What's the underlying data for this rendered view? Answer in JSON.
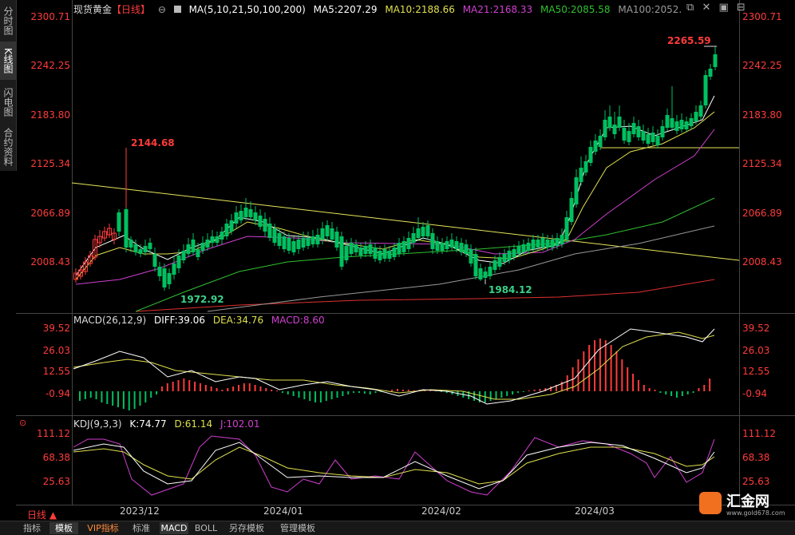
{
  "sidebar": {
    "tabs": [
      {
        "label": "分时图",
        "active": false
      },
      {
        "label": "K线图",
        "active": true
      },
      {
        "label": "闪电图",
        "active": false
      },
      {
        "label": "合约资料",
        "active": false
      }
    ]
  },
  "legend_main": {
    "symbol": "现货黄金",
    "period": "【日线】",
    "ma_spec": "MA(5,10,21,50,100,200)",
    "ma5": "MA5:2207.29",
    "ma10": "MA10:2188.66",
    "ma21": "MA21:2168.33",
    "ma50": "MA50:2085.58",
    "ma100": "MA100:2052."
  },
  "legend_macd": {
    "label": "MACD(26,12,9)",
    "diff": "DIFF:39.06",
    "dea": "DEA:34.76",
    "macd": "MACD:8.60"
  },
  "legend_kdj": {
    "label": "KDJ(9,3,3)",
    "k": "K:74.77",
    "d": "D:61.14",
    "j": "J:102.01"
  },
  "price_axis": [
    "2300.71",
    "2242.25",
    "2183.80",
    "2125.34",
    "2066.89",
    "2008.43"
  ],
  "macd_axis": [
    "39.52",
    "26.03",
    "12.55",
    "-0.94"
  ],
  "kdj_axis": [
    "111.12",
    "68.38",
    "25.63"
  ],
  "x_labels": [
    "2023/12",
    "2024/01",
    "2024/02",
    "2024/03"
  ],
  "period_type": "日线 ▲",
  "annotations": {
    "high1": "2144.68",
    "low1": "1972.92",
    "low2": "1984.12",
    "high2": "2265.59"
  },
  "bottom_tabs": [
    {
      "label": "指标",
      "active": false
    },
    {
      "label": "模板",
      "active": true
    },
    {
      "label": "VIP指标",
      "active": false
    },
    {
      "label": "标准",
      "active": false
    },
    {
      "label": "MACD",
      "active": true
    },
    {
      "label": "BOLL",
      "active": false
    },
    {
      "label": "另存模板",
      "active": false
    },
    {
      "label": "管理模板",
      "active": false
    }
  ],
  "logo": {
    "text": "汇金网",
    "url_text": "www.gold678.com"
  },
  "colors": {
    "up": "#ff3b3b",
    "down": "#00c060",
    "ma5": "#ffffff",
    "ma10": "#e0e050",
    "ma21": "#d040d0",
    "ma50": "#30c030",
    "ma100": "#aaaaaa",
    "ma200": "#e03030"
  }
}
